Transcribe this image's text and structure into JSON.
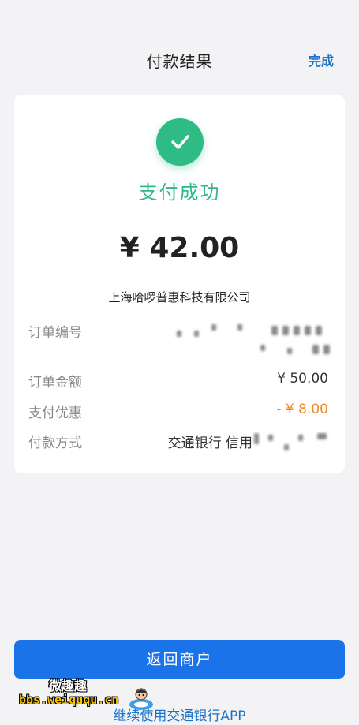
{
  "header": {
    "title": "付款结果",
    "done_label": "完成"
  },
  "result": {
    "status": "支付成功",
    "amount": "¥ 42.00",
    "merchant": "上海哈啰普惠科技有限公司"
  },
  "details": {
    "order_no": {
      "label": "订单编号",
      "value": ""
    },
    "order_amount": {
      "label": "订单金额",
      "value": "¥ 50.00"
    },
    "discount": {
      "label": "支付优惠",
      "value": "- ¥ 8.00"
    },
    "payment_method": {
      "label": "付款方式",
      "value": "交通银行 信用"
    }
  },
  "actions": {
    "return_label": "返回商户",
    "continue_label": "继续使用交通银行APP"
  },
  "watermark": {
    "line1": "微趣趣",
    "line2": "bbs.weiququ.cn"
  },
  "colors": {
    "success": "#2ebb84",
    "primary": "#1a73e8",
    "link": "#1a73c9",
    "discount": "#f08a24"
  },
  "icons": {
    "success": "check-icon"
  }
}
